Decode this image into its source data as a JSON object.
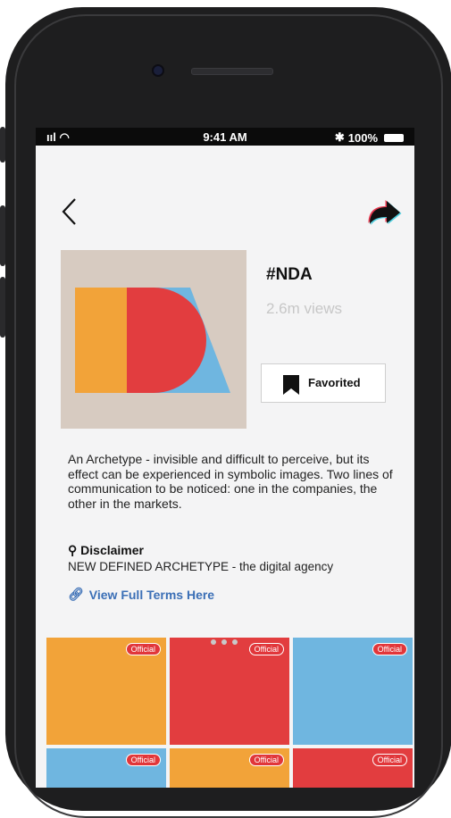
{
  "status": {
    "time": "9:41 AM",
    "battery": "100%"
  },
  "item": {
    "title": "#NDA",
    "views": "2.6m views",
    "favorite_label": "Favorited",
    "description": "An Archetype - invisible and difficult to perceive, but its effect can be experienced in symbolic images. Two lines of communication to be noticed: one in the companies, the other in the markets.",
    "disclaimer_title": "Disclaimer",
    "disclaimer_text": "NEW DEFINED ARCHETYPE - the digital agency",
    "terms_link": "View Full Terms Here"
  },
  "colors": {
    "orange": "#f2a339",
    "red": "#e23d3f",
    "blue": "#6fb6e0",
    "cover_bg": "#d7cbc1",
    "link": "#3b6fb6"
  },
  "grid": {
    "tiles": [
      {
        "color": "#f2a339",
        "badge": "Official"
      },
      {
        "color": "#e23d3f",
        "badge": "Official"
      },
      {
        "color": "#6fb6e0",
        "badge": "Official"
      },
      {
        "color": "#6fb6e0",
        "badge": "Official"
      },
      {
        "color": "#f2a339",
        "badge": "Official"
      },
      {
        "color": "#e23d3f",
        "badge": "Official"
      }
    ]
  }
}
